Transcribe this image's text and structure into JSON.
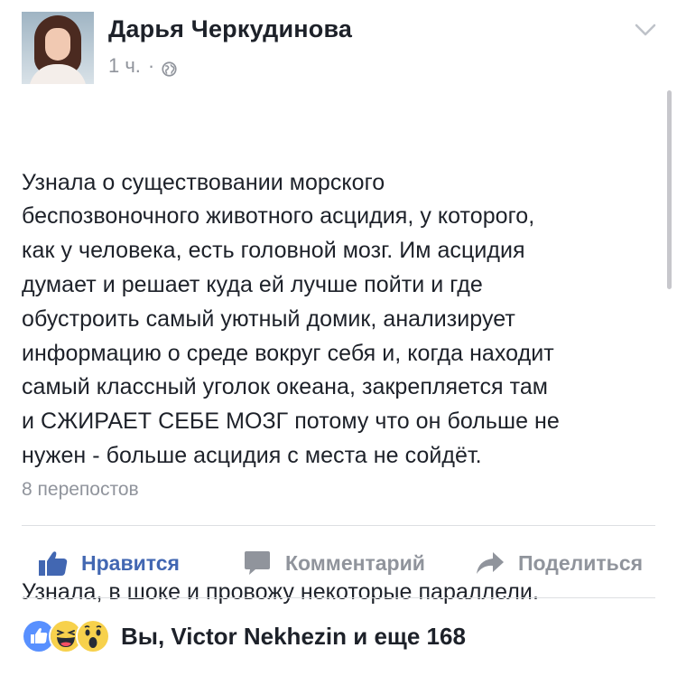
{
  "post": {
    "author": "Дарья Черкудинова",
    "time": "1 ч.",
    "separator": "·",
    "visibility_icon": "globe-icon",
    "menu_icon": "chevron-down-icon",
    "paragraphs": [
      "Узнала о существовании морского\nбеспозвоночного животного асцидия, у которого,\nкак у человека, есть головной мозг. Им асцидия\nдумает и решает куда ей лучше пойти и где\nобустроить самый уютный домик, анализирует\nинформацию о среде вокруг себя и, когда находит\nсамый классный уголок океана, закрепляется там\nи СЖИРАЕТ СЕБЕ МОЗГ потому что он больше не\nнужен - больше асцидия с места не сойдёт.",
      "Узнала, в шоке и провожу некоторые параллели."
    ],
    "shares": "8 перепостов"
  },
  "actions": {
    "like": {
      "label": "Нравится",
      "icon": "thumbs-up-icon"
    },
    "comment": {
      "label": "Комментарий",
      "icon": "comment-icon"
    },
    "share": {
      "label": "Поделиться",
      "icon": "share-arrow-icon"
    }
  },
  "reactions": {
    "icons": [
      "like-reaction-icon",
      "haha-reaction-icon",
      "wow-reaction-icon"
    ],
    "summary": "Вы, Victor Nekhezin и еще 168"
  },
  "colors": {
    "accent": "#4267b2",
    "text": "#1d2129",
    "secondary": "#90949c",
    "divider": "#dddfe2",
    "reaction_yellow": "#f7d14c"
  }
}
